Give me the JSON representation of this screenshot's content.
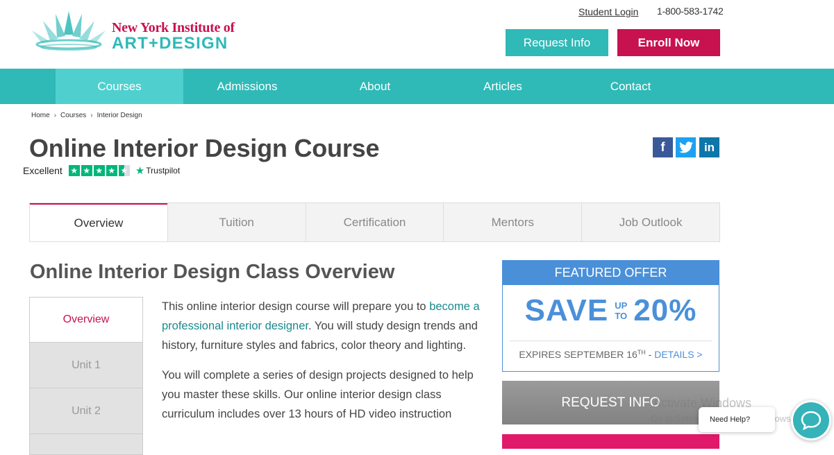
{
  "header": {
    "logo_line1": "New York Institute of",
    "logo_line2": "ART+DESIGN",
    "student_login": "Student Login",
    "phone": "1-800-583-1742",
    "request_info": "Request Info",
    "enroll_now": "Enroll Now"
  },
  "nav": {
    "items": [
      "Courses",
      "Admissions",
      "About",
      "Articles",
      "Contact"
    ],
    "active": "Courses"
  },
  "breadcrumb": [
    "Home",
    "Courses",
    "Interior Design"
  ],
  "page_title": "Online Interior Design Course",
  "rating": {
    "label": "Excellent",
    "provider": "Trustpilot",
    "stars": 4.5
  },
  "social": [
    "facebook-icon",
    "twitter-icon",
    "linkedin-icon"
  ],
  "tabs": [
    "Overview",
    "Tuition",
    "Certification",
    "Mentors",
    "Job Outlook"
  ],
  "section_title": "Online Interior Design Class Overview",
  "units": [
    "Overview",
    "Unit 1",
    "Unit 2"
  ],
  "body": {
    "p1_before": "This online interior design course will prepare you to ",
    "p1_link": "become a professional interior designer",
    "p1_after": ". You will study design trends and history, furniture styles and fabrics, color theory and lighting.",
    "p2": "You will complete a series of design projects designed to help you master these skills. Our online interior design class curriculum includes over 13 hours of HD video instruction"
  },
  "offer": {
    "header": "FEATURED OFFER",
    "save": "SAVE",
    "up": "UP",
    "to": "TO",
    "percent": "20%",
    "expires": "EXPIRES SEPTEMBER 16",
    "expires_sup": "TH",
    "dash": " - ",
    "details": "DETAILS >"
  },
  "request_info_big": "REQUEST INFO",
  "watermark": {
    "line1": "Activate Windows",
    "line2": "Go to Settings to activate Windows."
  },
  "chat": {
    "help_text": "Need Help?"
  },
  "colors": {
    "teal": "#2fb9b7",
    "crimson": "#c8114f",
    "blue": "#4a90d9",
    "trustpilot": "#00b67a"
  }
}
